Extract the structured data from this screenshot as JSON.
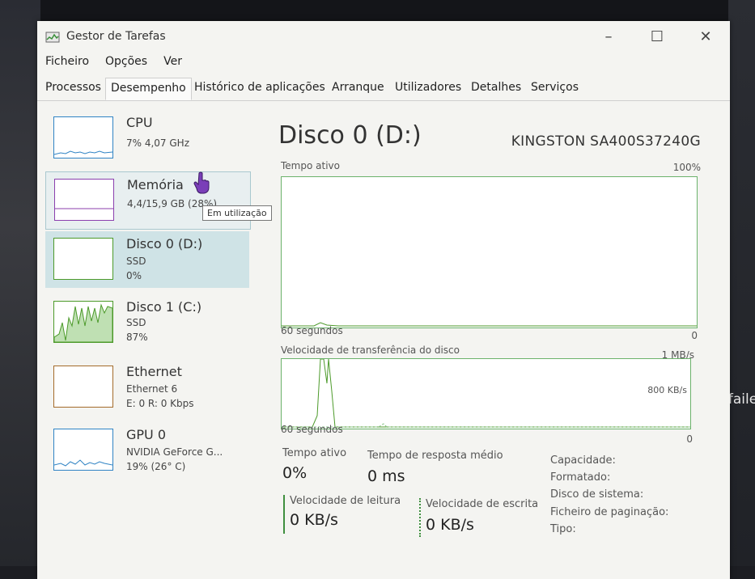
{
  "window": {
    "title": "Gestor de Tarefas",
    "controls": {
      "minimize": "–",
      "maximize": "☐",
      "close": "✕"
    }
  },
  "menu": [
    "Ficheiro",
    "Opções",
    "Ver"
  ],
  "tabs": [
    "Processos",
    "Desempenho",
    "Histórico de aplicações",
    "Arranque",
    "Utilizadores",
    "Detalhes",
    "Serviços"
  ],
  "active_tab": "Desempenho",
  "sidebar": {
    "items": [
      {
        "name": "CPU",
        "line1": "7% 4,07 GHz",
        "line2": "",
        "color": "#2f83c4"
      },
      {
        "name": "Memória",
        "line1": "4,4/15,9 GB (28%)",
        "line2": "",
        "color": "#8b3fae"
      },
      {
        "name": "Disco 0 (D:)",
        "line1": "SSD",
        "line2": "0%",
        "color": "#4c9a2a"
      },
      {
        "name": "Disco 1 (C:)",
        "line1": "SSD",
        "line2": "87%",
        "color": "#4c9a2a"
      },
      {
        "name": "Ethernet",
        "line1": "Ethernet 6",
        "line2": "E: 0 R: 0 Kbps",
        "color": "#a46b2a"
      },
      {
        "name": "GPU 0",
        "line1": "NVIDIA GeForce G...",
        "line2": "19% (26° C)",
        "color": "#2f83c4"
      }
    ],
    "tooltip": "Em utilização"
  },
  "main": {
    "title": "Disco 0 (D:)",
    "model": "KINGSTON SA400S37240G",
    "graph1": {
      "label": "Tempo ativo",
      "max": "100%",
      "time": "60 segundos",
      "min": "0"
    },
    "graph2": {
      "label": "Velocidade de transferência do disco",
      "max": "1 MB/s",
      "mid": "800 KB/s",
      "time": "60 segundos",
      "min": "0"
    },
    "stats": {
      "active_time_label": "Tempo ativo",
      "active_time_value": "0%",
      "response_label": "Tempo de resposta médio",
      "response_value": "0 ms",
      "read_label": "Velocidade de leitura",
      "read_value": "0 KB/s",
      "write_label": "Velocidade de escrita",
      "write_value": "0 KB/s"
    },
    "properties": [
      "Capacidade:",
      "Formatado:",
      "Disco de sistema:",
      "Ficheiro de paginação:",
      "Tipo:"
    ]
  },
  "background_text": "e faile",
  "colors": {
    "disk_green": "#4c9a2a",
    "selected_bg": "#cfe3e6",
    "cursor": "#7a3fb8"
  }
}
